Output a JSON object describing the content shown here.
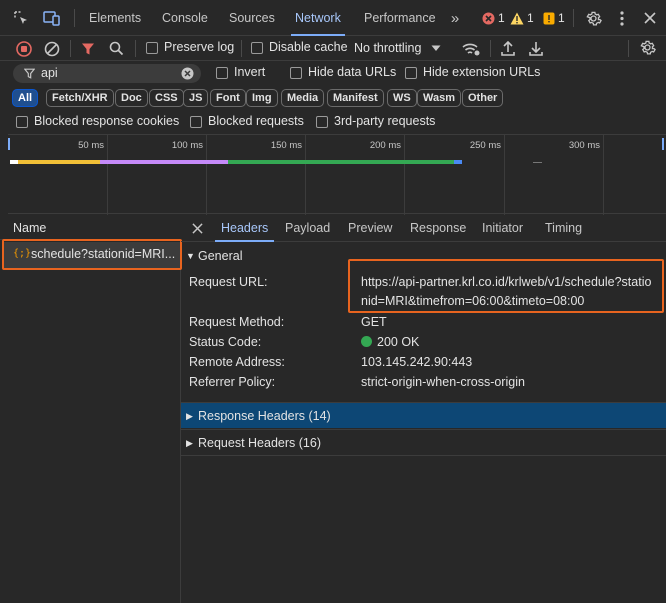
{
  "tabs": [
    "Elements",
    "Console",
    "Sources",
    "Network",
    "Performance"
  ],
  "active_tab": "Network",
  "badges": {
    "errors": "1",
    "warnings": "1",
    "issues": "1"
  },
  "toolbar": {
    "preserve_log": "Preserve log",
    "disable_cache": "Disable cache",
    "throttling": "No throttling"
  },
  "filter": {
    "value": "api",
    "invert": "Invert",
    "hide_data_urls": "Hide data URLs",
    "hide_extension_urls": "Hide extension URLs"
  },
  "types": [
    "All",
    "Fetch/XHR",
    "Doc",
    "CSS",
    "JS",
    "Font",
    "Img",
    "Media",
    "Manifest",
    "WS",
    "Wasm",
    "Other"
  ],
  "blocked": {
    "cookies": "Blocked response cookies",
    "requests": "Blocked requests",
    "third_party": "3rd-party requests"
  },
  "overview": {
    "ticks": [
      "50 ms",
      "100 ms",
      "150 ms",
      "200 ms",
      "250 ms",
      "300 ms"
    ]
  },
  "list": {
    "header": "Name",
    "rows": [
      {
        "name": "schedule?stationid=MRI..."
      }
    ]
  },
  "details": {
    "tabs": [
      "Headers",
      "Payload",
      "Preview",
      "Response",
      "Initiator",
      "Timing"
    ],
    "active_tab": "Headers",
    "general_title": "General",
    "general": [
      {
        "key": "Request URL:",
        "value_line1": "https://api-partner.krl.co.id/krlweb/v1/schedule?statio",
        "value_line2": "nid=MRI&timefrom=06:00&timeto=08:00"
      },
      {
        "key": "Request Method:",
        "value": "GET"
      },
      {
        "key": "Status Code:",
        "value": "200 OK"
      },
      {
        "key": "Remote Address:",
        "value": "103.145.242.90:443"
      },
      {
        "key": "Referrer Policy:",
        "value": "strict-origin-when-cross-origin"
      }
    ],
    "response_headers": "Response Headers (14)",
    "request_headers": "Request Headers (16)"
  },
  "colors": {
    "accent": "#7cacf8",
    "highlight": "#e8641f",
    "status_ok": "#34a853"
  }
}
